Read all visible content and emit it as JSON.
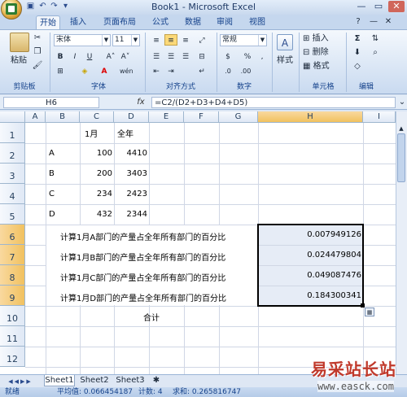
{
  "window": {
    "title": "Book1 - Microsoft Excel",
    "minimize": "—",
    "restore": "▭",
    "close": "✕"
  },
  "tabs": [
    "开始",
    "插入",
    "页面布局",
    "公式",
    "数据",
    "审阅",
    "视图"
  ],
  "ribbon": {
    "clipboard": {
      "label": "剪贴板",
      "paste": "粘贴"
    },
    "font": {
      "label": "字体",
      "name": "宋体",
      "size": "11",
      "bold": "B",
      "italic": "I",
      "underline": "U",
      "grow": "A˄",
      "shrink": "A˅",
      "font_color": "A",
      "phonetic": "wén"
    },
    "alignment": {
      "label": "对齐方式"
    },
    "number": {
      "label": "数字",
      "format": "常规",
      "percent": "%",
      "comma": ","
    },
    "styles": {
      "label": "样式",
      "button": "样式"
    },
    "cells": {
      "label": "单元格",
      "insert": "插入",
      "delete": "删除",
      "format": "格式"
    },
    "editing": {
      "label": "编辑",
      "sum": "Σ"
    }
  },
  "formula_bar": {
    "name_box": "H6",
    "fx": "fx",
    "formula": "=C2/(D2+D3+D4+D5)"
  },
  "columns": [
    "A",
    "B",
    "C",
    "D",
    "E",
    "F",
    "G",
    "H",
    "I"
  ],
  "rows": [
    "1",
    "2",
    "3",
    "4",
    "5",
    "6",
    "7",
    "8",
    "9",
    "10",
    "11",
    "12"
  ],
  "cells": {
    "C1": "1月",
    "D1": "全年",
    "B2": "A",
    "C2": "100",
    "D2": "4410",
    "B3": "B",
    "C3": "200",
    "D3": "3403",
    "B4": "C",
    "C4": "234",
    "D4": "2423",
    "B5": "D",
    "C5": "432",
    "D5": "2344",
    "B6": "计算1月A部门的产量占全年所有部门的百分比",
    "B7": "计算1月B部门的产量占全年所有部门的百分比",
    "B8": "计算1月C部门的产量占全年所有部门的百分比",
    "B9": "计算1月D部门的产量占全年所有部门的百分比",
    "H6": "0.007949126",
    "H7": "0.024479804",
    "H8": "0.049087476",
    "H9": "0.184300341",
    "D10": "合计"
  },
  "sheets": [
    "Sheet1",
    "Sheet2",
    "Sheet3"
  ],
  "status": {
    "mode": "就绪",
    "average": "平均值: 0.066454187",
    "count": "计数: 4",
    "sum": "求和: 0.265816747"
  },
  "watermark": {
    "line1": "易采站长站",
    "line2": "www.easck.com"
  },
  "colors": {
    "ribbon_text": "#15428b",
    "selection_border": "#000000",
    "selected_header": "#f1c15f",
    "watermark": "#c0392b"
  }
}
